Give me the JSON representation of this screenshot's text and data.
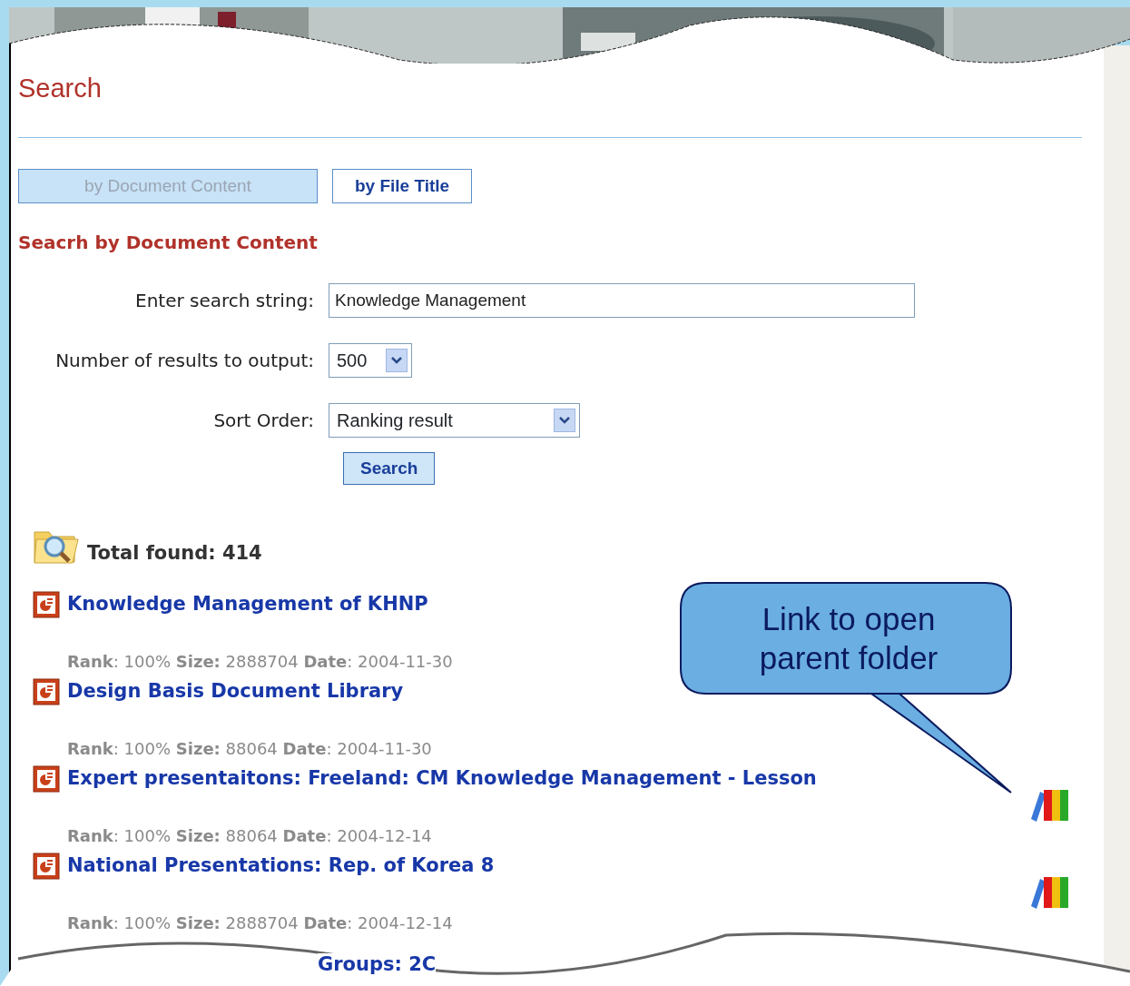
{
  "page_title": "Search",
  "tabs": [
    {
      "label": "by Document Content",
      "selected": true
    },
    {
      "label": "by File Title",
      "selected": false
    }
  ],
  "section_title": "Seacrh by Document Content",
  "form": {
    "search_label": "Enter search string:",
    "search_value": "Knowledge Management",
    "count_label": "Number of results to output:",
    "count_value": "500",
    "sort_label": "Sort Order:",
    "sort_value": "Ranking result",
    "submit": "Search"
  },
  "total_found": "Total found: 414",
  "results": [
    {
      "title": "Knowledge Management of KHNP",
      "meta": "**Rank**: 100% **Size:** 2888704 **Date**: 2004-11-30",
      "folder_link": false
    },
    {
      "title": "Design Basis Document Library",
      "meta": "**Rank**: 100% **Size:** 88064 **Date**: 2004-11-30",
      "folder_link": false
    },
    {
      "title": "Expert presentaitons: Freeland: CM Knowledge Management - Lesson",
      "meta": "**Rank**: 100% **Size:** 88064 **Date**: 2004-12-14",
      "folder_link": true
    },
    {
      "title": "National Presentations: Rep. of Korea 8",
      "meta": "**Rank**: 100% **Size:** 2888704 **Date**: 2004-12-14",
      "folder_link": true
    }
  ],
  "cut_text": "Groups: 2C",
  "callout": "Link to open parent folder"
}
